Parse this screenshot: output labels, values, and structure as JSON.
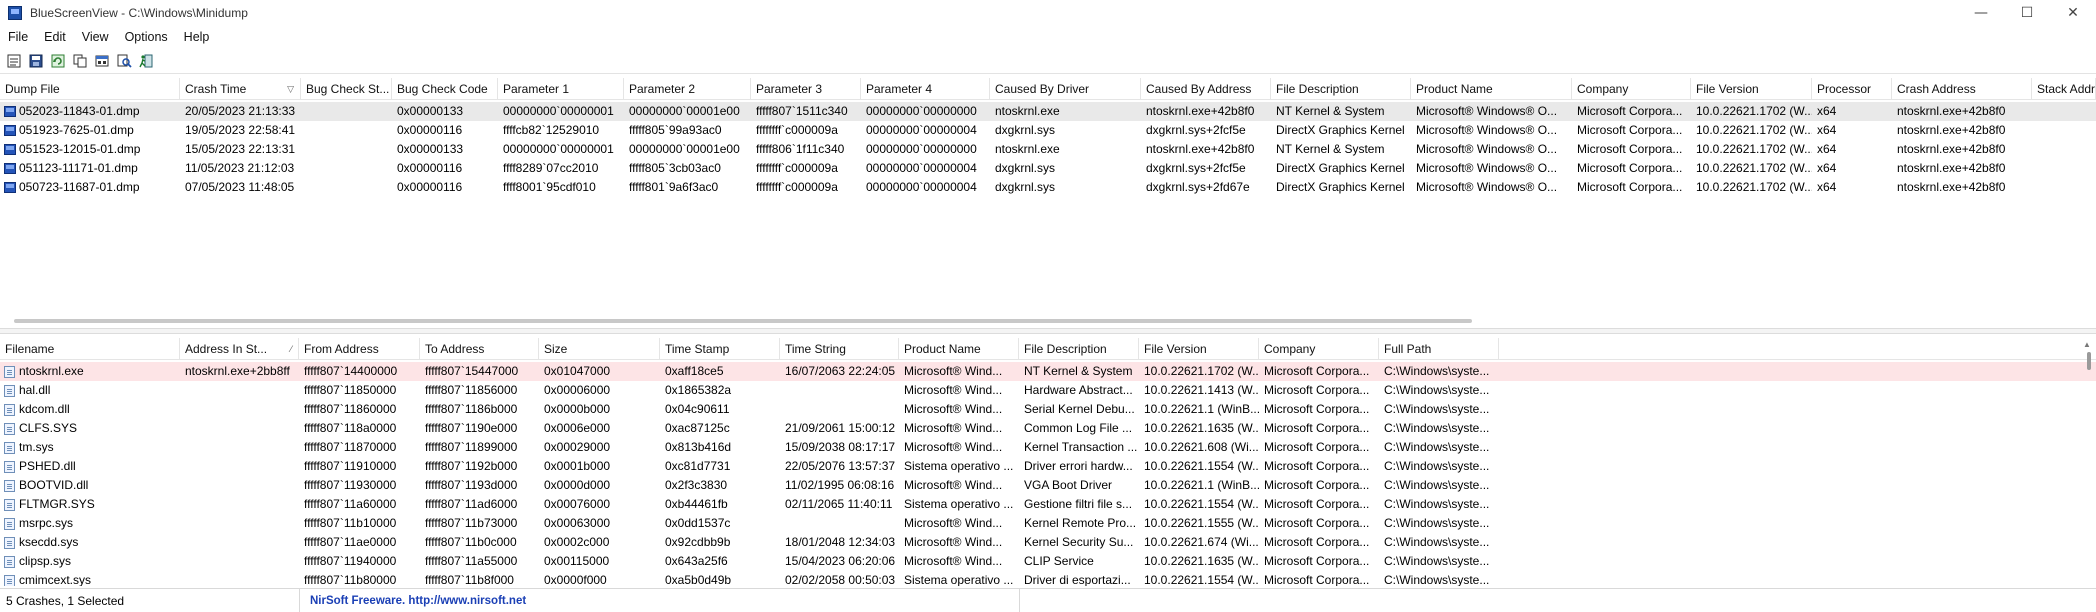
{
  "window": {
    "title": "BlueScreenView  -  C:\\Windows\\Minidump",
    "controls": [
      "—",
      "☐",
      "✕"
    ]
  },
  "menu": [
    "File",
    "Edit",
    "View",
    "Options",
    "Help"
  ],
  "toolbar": [
    {
      "name": "properties-icon"
    },
    {
      "name": "save-icon"
    },
    {
      "name": "refresh-icon"
    },
    {
      "name": "copy-icon"
    },
    {
      "name": "advanced-options-icon"
    },
    {
      "name": "find-icon"
    },
    {
      "name": "exit-icon"
    }
  ],
  "crashes": {
    "columns": [
      {
        "label": "Dump File",
        "w": 180
      },
      {
        "label": "Crash Time",
        "w": 121,
        "sort": "▽"
      },
      {
        "label": "Bug Check St...",
        "w": 91
      },
      {
        "label": "Bug Check Code",
        "w": 106
      },
      {
        "label": "Parameter 1",
        "w": 126
      },
      {
        "label": "Parameter 2",
        "w": 127
      },
      {
        "label": "Parameter 3",
        "w": 110
      },
      {
        "label": "Parameter 4",
        "w": 129
      },
      {
        "label": "Caused By Driver",
        "w": 151
      },
      {
        "label": "Caused By Address",
        "w": 130
      },
      {
        "label": "File Description",
        "w": 140
      },
      {
        "label": "Product Name",
        "w": 161
      },
      {
        "label": "Company",
        "w": 119
      },
      {
        "label": "File Version",
        "w": 121
      },
      {
        "label": "Processor",
        "w": 80
      },
      {
        "label": "Crash Address",
        "w": 140
      },
      {
        "label": "Stack Addr",
        "w": 64
      }
    ],
    "rows": [
      [
        "052023-11843-01.dmp",
        "20/05/2023 21:13:33",
        "",
        "0x00000133",
        "00000000`00000001",
        "00000000`00001e00",
        "fffff807`1511c340",
        "00000000`00000000",
        "ntoskrnl.exe",
        "ntoskrnl.exe+42b8f0",
        "NT Kernel & System",
        "Microsoft® Windows® O...",
        "Microsoft Corpora...",
        "10.0.22621.1702 (W...",
        "x64",
        "ntoskrnl.exe+42b8f0",
        ""
      ],
      [
        "051923-7625-01.dmp",
        "19/05/2023 22:58:41",
        "",
        "0x00000116",
        "ffffcb82`12529010",
        "fffff805`99a93ac0",
        "ffffffff`c000009a",
        "00000000`00000004",
        "dxgkrnl.sys",
        "dxgkrnl.sys+2fcf5e",
        "DirectX Graphics Kernel",
        "Microsoft® Windows® O...",
        "Microsoft Corpora...",
        "10.0.22621.1702 (W...",
        "x64",
        "ntoskrnl.exe+42b8f0",
        ""
      ],
      [
        "051523-12015-01.dmp",
        "15/05/2023 22:13:31",
        "",
        "0x00000133",
        "00000000`00000001",
        "00000000`00001e00",
        "fffff806`1f11c340",
        "00000000`00000000",
        "ntoskrnl.exe",
        "ntoskrnl.exe+42b8f0",
        "NT Kernel & System",
        "Microsoft® Windows® O...",
        "Microsoft Corpora...",
        "10.0.22621.1702 (W...",
        "x64",
        "ntoskrnl.exe+42b8f0",
        ""
      ],
      [
        "051123-11171-01.dmp",
        "11/05/2023 21:12:03",
        "",
        "0x00000116",
        "ffff8289`07cc2010",
        "fffff805`3cb03ac0",
        "ffffffff`c000009a",
        "00000000`00000004",
        "dxgkrnl.sys",
        "dxgkrnl.sys+2fcf5e",
        "DirectX Graphics Kernel",
        "Microsoft® Windows® O...",
        "Microsoft Corpora...",
        "10.0.22621.1702 (W...",
        "x64",
        "ntoskrnl.exe+42b8f0",
        ""
      ],
      [
        "050723-11687-01.dmp",
        "07/05/2023 11:48:05",
        "",
        "0x00000116",
        "ffff8001`95cdf010",
        "fffff801`9a6f3ac0",
        "ffffffff`c000009a",
        "00000000`00000004",
        "dxgkrnl.sys",
        "dxgkrnl.sys+2fd67e",
        "DirectX Graphics Kernel",
        "Microsoft® Windows® O...",
        "Microsoft Corpora...",
        "10.0.22621.1702 (W...",
        "x64",
        "ntoskrnl.exe+42b8f0",
        ""
      ]
    ]
  },
  "drivers": {
    "columns": [
      {
        "label": "Filename",
        "w": 180
      },
      {
        "label": "Address In St...",
        "w": 119,
        "sort": "⁄"
      },
      {
        "label": "From Address",
        "w": 121
      },
      {
        "label": "To Address",
        "w": 119
      },
      {
        "label": "Size",
        "w": 121
      },
      {
        "label": "Time Stamp",
        "w": 120
      },
      {
        "label": "Time String",
        "w": 119
      },
      {
        "label": "Product Name",
        "w": 120
      },
      {
        "label": "File Description",
        "w": 120
      },
      {
        "label": "File Version",
        "w": 120
      },
      {
        "label": "Company",
        "w": 120
      },
      {
        "label": "Full Path",
        "w": 120
      }
    ],
    "rows": [
      [
        "ntoskrnl.exe",
        "ntoskrnl.exe+2bb8ff",
        "fffff807`14400000",
        "fffff807`15447000",
        "0x01047000",
        "0xaff18ce5",
        "16/07/2063 22:24:05",
        "Microsoft® Wind...",
        "NT Kernel & System",
        "10.0.22621.1702 (W...",
        "Microsoft Corpora...",
        "C:\\Windows\\syste..."
      ],
      [
        "hal.dll",
        "",
        "fffff807`11850000",
        "fffff807`11856000",
        "0x00006000",
        "0x1865382a",
        "",
        "Microsoft® Wind...",
        "Hardware Abstract...",
        "10.0.22621.1413 (W...",
        "Microsoft Corpora...",
        "C:\\Windows\\syste..."
      ],
      [
        "kdcom.dll",
        "",
        "fffff807`11860000",
        "fffff807`1186b000",
        "0x0000b000",
        "0x04c90611",
        "",
        "Microsoft® Wind...",
        "Serial Kernel Debu...",
        "10.0.22621.1 (WinB...",
        "Microsoft Corpora...",
        "C:\\Windows\\syste..."
      ],
      [
        "CLFS.SYS",
        "",
        "fffff807`118a0000",
        "fffff807`1190e000",
        "0x0006e000",
        "0xac87125c",
        "21/09/2061 15:00:12",
        "Microsoft® Wind...",
        "Common Log File ...",
        "10.0.22621.1635 (W...",
        "Microsoft Corpora...",
        "C:\\Windows\\syste..."
      ],
      [
        "tm.sys",
        "",
        "fffff807`11870000",
        "fffff807`11899000",
        "0x00029000",
        "0x813b416d",
        "15/09/2038 08:17:17",
        "Microsoft® Wind...",
        "Kernel Transaction ...",
        "10.0.22621.608 (Wi...",
        "Microsoft Corpora...",
        "C:\\Windows\\syste..."
      ],
      [
        "PSHED.dll",
        "",
        "fffff807`11910000",
        "fffff807`1192b000",
        "0x0001b000",
        "0xc81d7731",
        "22/05/2076 13:57:37",
        "Sistema operativo ...",
        "Driver errori hardw...",
        "10.0.22621.1554 (W...",
        "Microsoft Corpora...",
        "C:\\Windows\\syste..."
      ],
      [
        "BOOTVID.dll",
        "",
        "fffff807`11930000",
        "fffff807`1193d000",
        "0x0000d000",
        "0x2f3c3830",
        "11/02/1995 06:08:16",
        "Microsoft® Wind...",
        "VGA Boot Driver",
        "10.0.22621.1 (WinB...",
        "Microsoft Corpora...",
        "C:\\Windows\\syste..."
      ],
      [
        "FLTMGR.SYS",
        "",
        "fffff807`11a60000",
        "fffff807`11ad6000",
        "0x00076000",
        "0xb44461fb",
        "02/11/2065 11:40:11",
        "Sistema operativo ...",
        "Gestione filtri file s...",
        "10.0.22621.1554 (W...",
        "Microsoft Corpora...",
        "C:\\Windows\\syste..."
      ],
      [
        "msrpc.sys",
        "",
        "fffff807`11b10000",
        "fffff807`11b73000",
        "0x00063000",
        "0x0dd1537c",
        "",
        "Microsoft® Wind...",
        "Kernel Remote Pro...",
        "10.0.22621.1555 (W...",
        "Microsoft Corpora...",
        "C:\\Windows\\syste..."
      ],
      [
        "ksecdd.sys",
        "",
        "fffff807`11ae0000",
        "fffff807`11b0c000",
        "0x0002c000",
        "0x92cdbb9b",
        "18/01/2048 12:34:03",
        "Microsoft® Wind...",
        "Kernel Security Su...",
        "10.0.22621.674 (Wi...",
        "Microsoft Corpora...",
        "C:\\Windows\\syste..."
      ],
      [
        "clipsp.sys",
        "",
        "fffff807`11940000",
        "fffff807`11a55000",
        "0x00115000",
        "0x643a25f6",
        "15/04/2023 06:20:06",
        "Microsoft® Wind...",
        "CLIP Service",
        "10.0.22621.1635 (W...",
        "Microsoft Corpora...",
        "C:\\Windows\\syste..."
      ],
      [
        "cmimcext.sys",
        "",
        "fffff807`11b80000",
        "fffff807`11b8f000",
        "0x0000f000",
        "0xa5b0d49b",
        "02/02/2058 00:50:03",
        "Sistema operativo ...",
        "Driver di esportazi...",
        "10.0.22621.1554 (W...",
        "Microsoft Corpora...",
        "C:\\Windows\\syste..."
      ]
    ]
  },
  "status": {
    "summary": "5 Crashes, 1 Selected",
    "freeware": "NirSoft Freeware.  http://www.nirsoft.net"
  },
  "colors": {
    "selected_row": "#e9e9e9",
    "highlight_row": "#fde4e6",
    "link": "#1a3fb5"
  }
}
